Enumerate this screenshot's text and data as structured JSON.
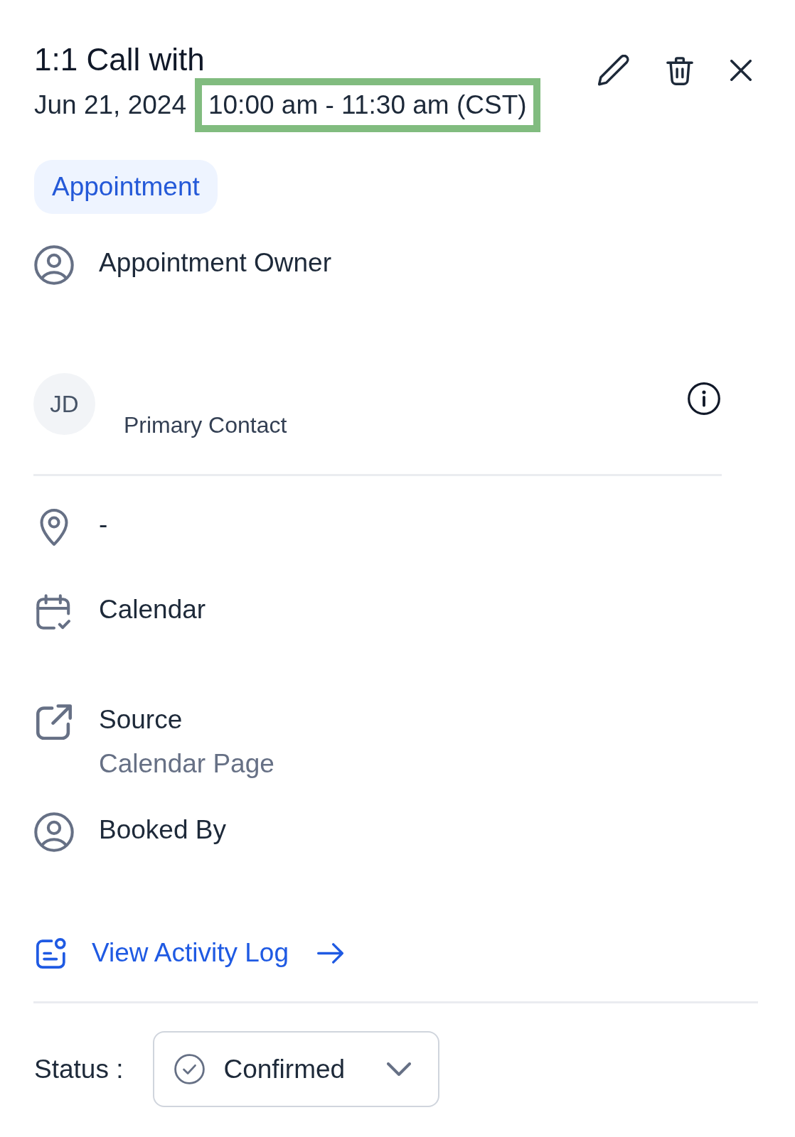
{
  "header": {
    "title": "1:1 Call with",
    "date": "Jun 21, 2024",
    "time": {
      "text": "10:00 am - 11:30 am (CST)",
      "highlighted": true
    }
  },
  "tag": {
    "label": "Appointment"
  },
  "owner": {
    "label": "Appointment Owner"
  },
  "contact": {
    "initials": "JD",
    "role": "Primary Contact"
  },
  "details": [
    {
      "kind": "location",
      "text": "-"
    },
    {
      "kind": "calendar",
      "text": "Calendar"
    },
    {
      "kind": "source",
      "text": "Source",
      "value": "Calendar Page"
    },
    {
      "kind": "booked_by",
      "text": "Booked By"
    }
  ],
  "activity_link": {
    "label": "View Activity Log"
  },
  "status": {
    "label": "Status :",
    "value": "Confirmed"
  }
}
